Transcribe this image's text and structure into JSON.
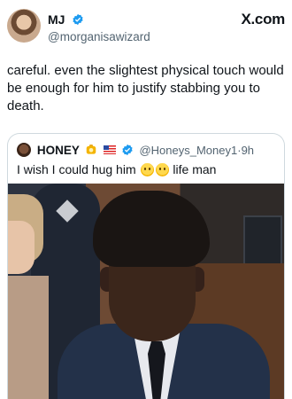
{
  "post": {
    "author_name": "MJ",
    "author_handle": "@morganisawizard",
    "source": "X.com",
    "text": "careful. even the slightest physical touch would be enough for him to justify stabbing you to death."
  },
  "quoted": {
    "author_name": "HONEY",
    "author_handle": "@Honeys_Money1",
    "separator": "·",
    "time": "9h",
    "text_before": "I wish I could hug him",
    "text_after": "life man",
    "emojis": [
      "pleading-face",
      "pleading-face"
    ],
    "image_alt": ""
  },
  "colors": {
    "text": "#0f1419",
    "secondary": "#536471",
    "verified_blue": "#1d9bf0",
    "border": "#cfd9de"
  },
  "icons": {
    "verified": "verified-badge-icon",
    "honey_badge": "gold-badge-icon",
    "flag": "us-flag-icon"
  }
}
